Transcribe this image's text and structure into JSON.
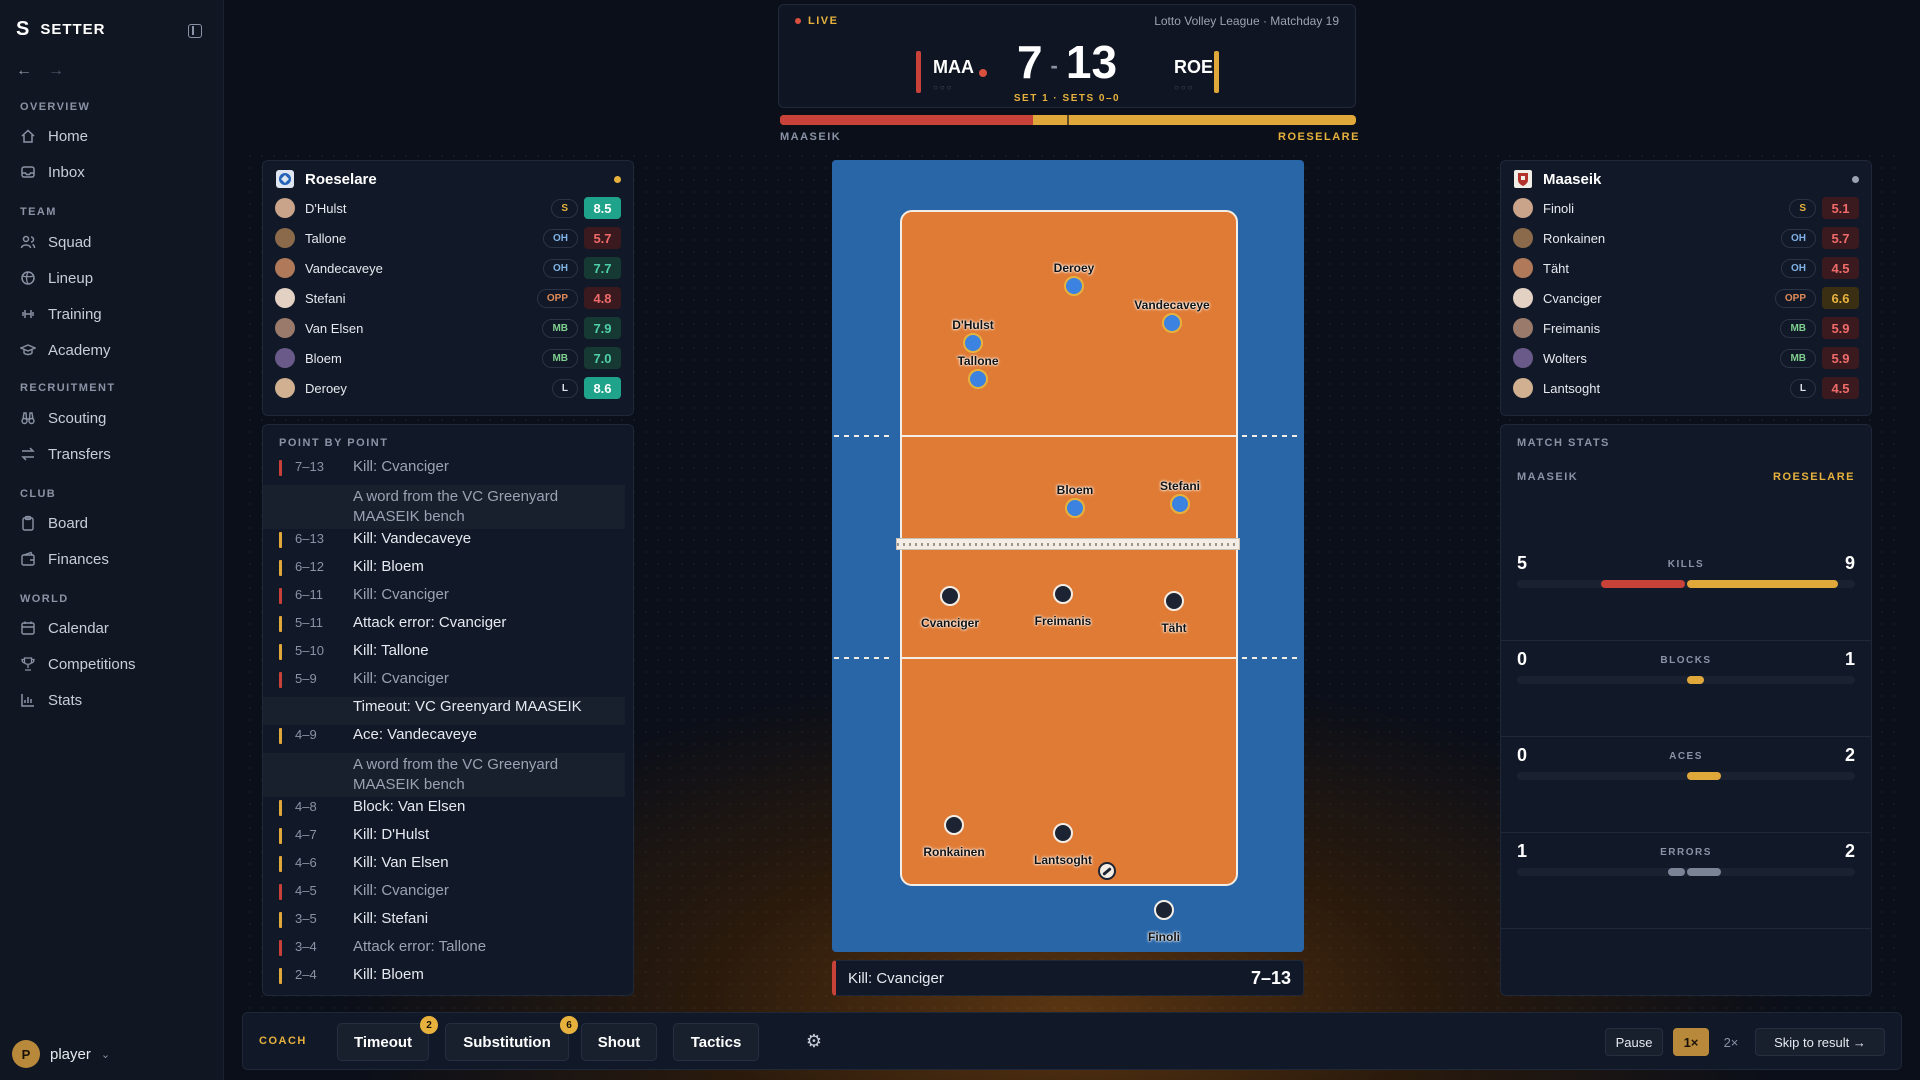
{
  "app": {
    "name": "SETTER"
  },
  "sidebar": {
    "sections": [
      {
        "title": "OVERVIEW",
        "items": [
          {
            "label": "Home",
            "icon": "home-icon"
          },
          {
            "label": "Inbox",
            "icon": "inbox-icon"
          }
        ]
      },
      {
        "title": "TEAM",
        "items": [
          {
            "label": "Squad",
            "icon": "users-icon"
          },
          {
            "label": "Lineup",
            "icon": "volleyball-icon"
          },
          {
            "label": "Training",
            "icon": "dumbbell-icon"
          },
          {
            "label": "Academy",
            "icon": "graduation-cap-icon"
          }
        ]
      },
      {
        "title": "RECRUITMENT",
        "items": [
          {
            "label": "Scouting",
            "icon": "binoculars-icon"
          },
          {
            "label": "Transfers",
            "icon": "arrows-swap-icon"
          }
        ]
      },
      {
        "title": "CLUB",
        "items": [
          {
            "label": "Board",
            "icon": "clipboard-icon"
          },
          {
            "label": "Finances",
            "icon": "wallet-icon"
          }
        ]
      },
      {
        "title": "WORLD",
        "items": [
          {
            "label": "Calendar",
            "icon": "calendar-icon"
          },
          {
            "label": "Competitions",
            "icon": "trophy-icon"
          },
          {
            "label": "Stats",
            "icon": "bar-chart-icon"
          }
        ]
      }
    ],
    "user": {
      "initial": "P",
      "name": "player"
    }
  },
  "scoreboard": {
    "live_label": "LIVE",
    "league": "Lotto Volley League · Matchday 19",
    "home_code": "MAA",
    "away_code": "ROE",
    "home_score": "7",
    "away_score": "13",
    "separator": "-",
    "set_info": "SET 1 · SETS 0–0",
    "home_color": "#c8423a",
    "away_color": "#e0a83a",
    "home_pips": "○○○",
    "away_pips": "○○○",
    "momentum_home_fraction": 0.44
  },
  "momentum": {
    "left_label": "MAASEIK",
    "right_label": "ROESELARE"
  },
  "roeselare": {
    "name": "Roeselare",
    "players": [
      {
        "name": "D'Hulst",
        "pos": "S",
        "rating": "8.5"
      },
      {
        "name": "Tallone",
        "pos": "OH",
        "rating": "5.7"
      },
      {
        "name": "Vandecaveye",
        "pos": "OH",
        "rating": "7.7"
      },
      {
        "name": "Stefani",
        "pos": "OPP",
        "rating": "4.8"
      },
      {
        "name": "Van Elsen",
        "pos": "MB",
        "rating": "7.9"
      },
      {
        "name": "Bloem",
        "pos": "MB",
        "rating": "7.0"
      },
      {
        "name": "Deroey",
        "pos": "L",
        "rating": "8.6"
      }
    ]
  },
  "maaseik": {
    "name": "Maaseik",
    "players": [
      {
        "name": "Finoli",
        "pos": "S",
        "rating": "5.1"
      },
      {
        "name": "Ronkainen",
        "pos": "OH",
        "rating": "5.7"
      },
      {
        "name": "Täht",
        "pos": "OH",
        "rating": "4.5"
      },
      {
        "name": "Cvanciger",
        "pos": "OPP",
        "rating": "6.6"
      },
      {
        "name": "Freimanis",
        "pos": "MB",
        "rating": "5.9"
      },
      {
        "name": "Wolters",
        "pos": "MB",
        "rating": "5.9"
      },
      {
        "name": "Lantsoght",
        "pos": "L",
        "rating": "4.5"
      }
    ]
  },
  "pbp": {
    "title": "POINT BY POINT",
    "events": [
      {
        "score": "7–13",
        "text": "Kill: Cvanciger",
        "team": "maa",
        "kind": "dim"
      },
      {
        "score": "",
        "text": "A word from the VC Greenyard MAASEIK bench",
        "team": "",
        "kind": "note"
      },
      {
        "score": "6–13",
        "text": "Kill: Vandecaveye",
        "team": "roe",
        "kind": "main"
      },
      {
        "score": "6–12",
        "text": "Kill: Bloem",
        "team": "roe",
        "kind": "main"
      },
      {
        "score": "6–11",
        "text": "Kill: Cvanciger",
        "team": "maa",
        "kind": "dim"
      },
      {
        "score": "5–11",
        "text": "Attack error: Cvanciger",
        "team": "roe",
        "kind": "main"
      },
      {
        "score": "5–10",
        "text": "Kill: Tallone",
        "team": "roe",
        "kind": "main"
      },
      {
        "score": "5–9",
        "text": "Kill: Cvanciger",
        "team": "maa",
        "kind": "dim"
      },
      {
        "score": "",
        "text": "Timeout: VC Greenyard MAASEIK",
        "team": "",
        "kind": "timeout"
      },
      {
        "score": "4–9",
        "text": "Ace: Vandecaveye",
        "team": "roe",
        "kind": "main"
      },
      {
        "score": "",
        "text": "A word from the VC Greenyard MAASEIK bench",
        "team": "",
        "kind": "note"
      },
      {
        "score": "4–8",
        "text": "Block: Van Elsen",
        "team": "roe",
        "kind": "main"
      },
      {
        "score": "4–7",
        "text": "Kill: D'Hulst",
        "team": "roe",
        "kind": "main"
      },
      {
        "score": "4–6",
        "text": "Kill: Van Elsen",
        "team": "roe",
        "kind": "main"
      },
      {
        "score": "4–5",
        "text": "Kill: Cvanciger",
        "team": "maa",
        "kind": "dim"
      },
      {
        "score": "3–5",
        "text": "Kill: Stefani",
        "team": "roe",
        "kind": "main"
      },
      {
        "score": "3–4",
        "text": "Attack error: Tallone",
        "team": "maa",
        "kind": "dim"
      },
      {
        "score": "2–4",
        "text": "Kill: Bloem",
        "team": "roe",
        "kind": "main"
      }
    ]
  },
  "court": {
    "roe_players": [
      "Deroey",
      "Vandecaveye",
      "D'Hulst",
      "Tallone",
      "Bloem",
      "Stefani"
    ],
    "maa_players": [
      "Cvanciger",
      "Freimanis",
      "Täht",
      "Ronkainen",
      "Lantsoght",
      "Finoli"
    ]
  },
  "last_event": {
    "text": "Kill: Cvanciger",
    "score": "7–13"
  },
  "match_stats": {
    "title": "MATCH STATS",
    "home_label": "MAASEIK",
    "away_label": "ROESELARE",
    "rows": [
      {
        "label": "KILLS",
        "home": 5,
        "away": 9,
        "home_color": "#c8423a",
        "away_color": "#e0a83a"
      },
      {
        "label": "BLOCKS",
        "home": 0,
        "away": 1,
        "home_color": "#c8423a",
        "away_color": "#e0a83a"
      },
      {
        "label": "ACES",
        "home": 0,
        "away": 2,
        "home_color": "#c8423a",
        "away_color": "#e0a83a"
      },
      {
        "label": "ERRORS",
        "home": 1,
        "away": 2,
        "home_color": "#7b8496",
        "away_color": "#7b8496"
      }
    ]
  },
  "actionbar": {
    "coach_label": "COACH",
    "timeout_label": "Timeout",
    "timeout_count": "2",
    "substitution_label": "Substitution",
    "substitution_count": "6",
    "shout_label": "Shout",
    "tactics_label": "Tactics",
    "pause_label": "Pause",
    "speed1_label": "1×",
    "speed2_label": "2×",
    "skip_label": "Skip to result →"
  }
}
